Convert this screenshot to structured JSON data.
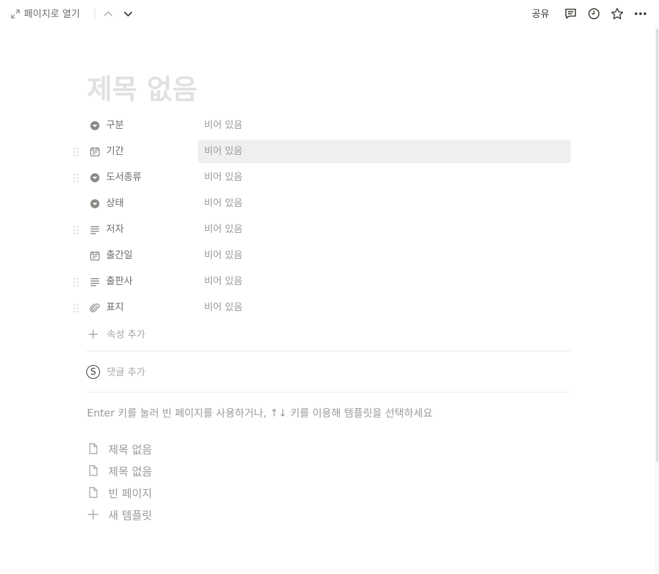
{
  "topbar": {
    "open_page_label": "페이지로 열기",
    "share_label": "공유",
    "icons": [
      "expand-icon",
      "chevron-up-icon",
      "chevron-down-icon",
      "comment-icon",
      "history-icon",
      "star-icon",
      "more-icon"
    ]
  },
  "page": {
    "title_placeholder": "제목 없음"
  },
  "properties": [
    {
      "name": "구분",
      "icon": "select-icon",
      "value": "비어 있음"
    },
    {
      "name": "기간",
      "icon": "date-icon",
      "value": "비어 있음"
    },
    {
      "name": "도서종류",
      "icon": "select-icon",
      "value": "비어 있음"
    },
    {
      "name": "상태",
      "icon": "select-icon",
      "value": "비어 있음"
    },
    {
      "name": "저자",
      "icon": "text-icon",
      "value": "비어 있음"
    },
    {
      "name": "출간일",
      "icon": "date-icon",
      "value": "비어 있음"
    },
    {
      "name": "출판사",
      "icon": "text-icon",
      "value": "비어 있음"
    },
    {
      "name": "표지",
      "icon": "paperclip-icon",
      "value": "비어 있음"
    }
  ],
  "add_property_label": "속성 추가",
  "comment": {
    "avatar_letter": "S",
    "placeholder": "댓글 추가"
  },
  "hint": "Enter 키를 눌러 빈 페이지를 사용하거나, ↑↓ 키를 이용해 템플릿을 선택하세요",
  "templates": [
    {
      "label": "제목 없음",
      "icon": "page-icon"
    },
    {
      "label": "제목 없음",
      "icon": "page-icon"
    },
    {
      "label": "빈 페이지",
      "icon": "page-icon"
    },
    {
      "label": "새 템플릿",
      "icon": "plus-icon"
    }
  ],
  "colors": {
    "text": "#37352f",
    "muted": "#9b9a97",
    "title_placeholder": "#e1e1e0",
    "hover_bg": "#efefef"
  }
}
